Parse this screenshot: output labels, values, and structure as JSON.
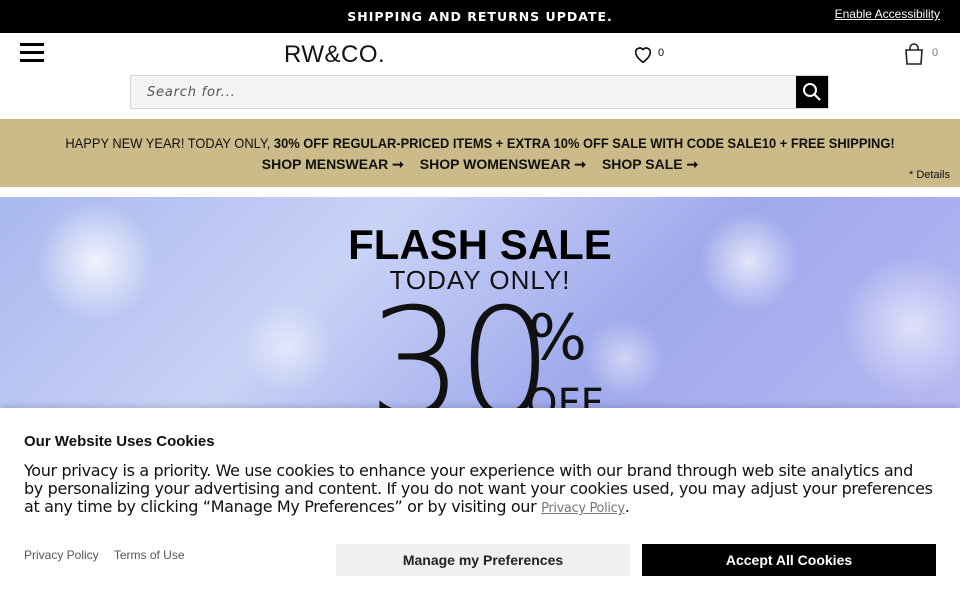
{
  "topbar": {
    "shipping_text": "SHIPPING AND RETURNS UPDATE.",
    "accessibility_link": "Enable Accessibility"
  },
  "header": {
    "logo_text": "RW&CO.",
    "wishlist_count": "0",
    "bag_count": "0",
    "search_placeholder": "Search for..."
  },
  "promo": {
    "line1_prefix": "HAPPY NEW YEAR! TODAY ONLY, ",
    "line1_bold": "30% OFF REGULAR-PRICED ITEMS + EXTRA 10% OFF SALE WITH CODE SALE10 + FREE SHIPPING!",
    "links": [
      "SHOP MENSWEAR ➞",
      "SHOP WOMENSWEAR ➞",
      "SHOP SALE ➞"
    ],
    "details": "* Details",
    "background": "#cbbb88"
  },
  "hero": {
    "title": "FLASH SALE",
    "subtitle": "TODAY ONLY!",
    "percent_number": "30",
    "percent_sign": "%",
    "off_text": "OFF"
  },
  "cookie_banner": {
    "title": "Our Website Uses Cookies",
    "body": "Your privacy is a priority. We use cookies to enhance your experience with our brand through web site analytics and by personalizing your advertising and content. If you do not want your cookies used, you may adjust your preferences at any time by clicking “Manage My Preferences” or by visiting our ",
    "privacy_link": "Privacy Policy",
    "body_end": ".",
    "footer_links": [
      "Privacy Policy",
      "Terms of Use"
    ],
    "manage_button": "Manage my Preferences",
    "accept_button": "Accept All Cookies"
  }
}
